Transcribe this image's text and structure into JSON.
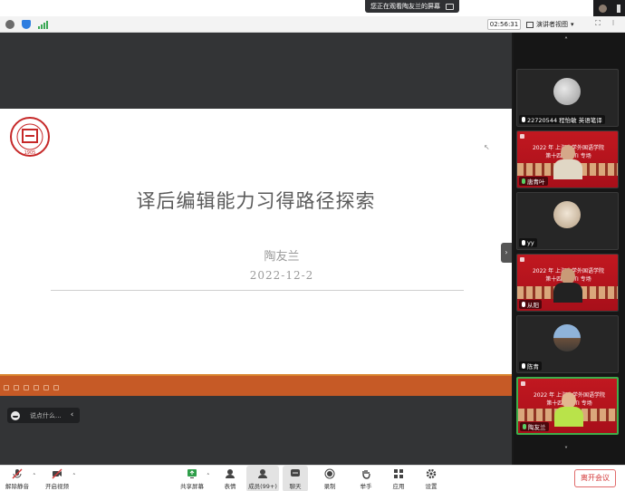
{
  "top_banner": {
    "sharing_text": "您正在观看陶友兰的屏幕"
  },
  "meeting_toolbar": {
    "timer": "02:56:31",
    "view_label": "演讲者视图",
    "view_caret": "▾"
  },
  "slide": {
    "title": "译后编辑能力习得路径探索",
    "author": "陶友兰",
    "date": "2022-12-2",
    "logo_year": "1905"
  },
  "chat": {
    "placeholder": "说点什么...",
    "collapse_glyph": "‹"
  },
  "side_toggle_glyph": "›",
  "panel": {
    "scroll_up": "˄",
    "scroll_down": "˅",
    "participants": [
      {
        "name": "22720544 程怡敏 英语笔译",
        "style": "avatar",
        "banner": ""
      },
      {
        "name": "唐青叶",
        "style": "red",
        "banner": "2022 年 上海大学外国语学院\n第十四届 MTI 专场"
      },
      {
        "name": "yy",
        "style": "avatar",
        "banner": ""
      },
      {
        "name": "从阳",
        "style": "red",
        "banner": "2022 年 上海大学外国语学院\n第十四届 MTI 专场"
      },
      {
        "name": "陈青",
        "style": "avatar",
        "banner": ""
      },
      {
        "name": "陶友兰",
        "style": "red",
        "banner": "2022 年 上海大学外国语学院\n第十四届 MTI 专场"
      }
    ]
  },
  "bottom_toolbar": {
    "mute": "解除静音",
    "video": "开启视频",
    "share": "共享屏幕",
    "react": "表情",
    "members": "成员(99+)",
    "chat": "聊天",
    "record": "录制",
    "raise_hand": "举手",
    "apps": "应用",
    "settings": "设置",
    "leave": "离开会议"
  },
  "colors": {
    "accent_green": "#3fae4b",
    "banner_red": "#c11820",
    "leave_red": "#d43a3a",
    "orange": "#c65a26"
  }
}
